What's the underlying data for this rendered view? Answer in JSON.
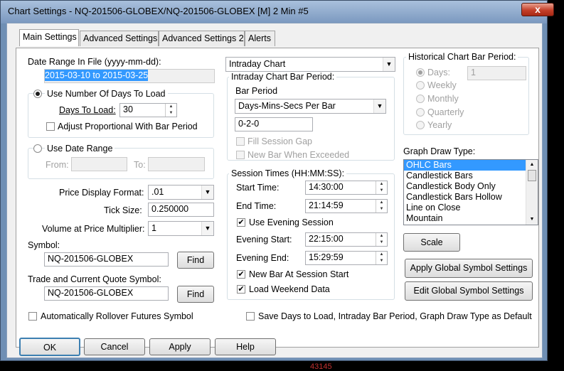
{
  "window": {
    "title": "Chart Settings - NQ-201506-GLOBEX/NQ-201506-GLOBEX [M]  2 Min  #5",
    "close": "x"
  },
  "tabs": [
    {
      "label": "Main Settings"
    },
    {
      "label": "Advanced Settings"
    },
    {
      "label": "Advanced Settings 2"
    },
    {
      "label": "Alerts"
    }
  ],
  "date_range_file": {
    "label": "Date Range In File (yyyy-mm-dd):",
    "value": "2015-03-10 to 2015-03-25"
  },
  "days_to_load": {
    "radio_label": "Use Number Of Days To Load",
    "days_label": "Days To Load:",
    "days_value": "30",
    "adjust_label": "Adjust Proportional With Bar Period"
  },
  "date_range": {
    "radio_label": "Use Date Range",
    "from_label": "From:",
    "to_label": "To:"
  },
  "price_display_format": {
    "label": "Price Display Format:",
    "value": ".01"
  },
  "tick_size": {
    "label": "Tick Size:",
    "value": "0.250000"
  },
  "volume_multiplier": {
    "label": "Volume at Price Multiplier:",
    "value": "1"
  },
  "symbol": {
    "label": "Symbol:",
    "value": "NQ-201506-GLOBEX",
    "find": "Find"
  },
  "trade_symbol": {
    "label": "Trade and Current Quote Symbol:",
    "value": "NQ-201506-GLOBEX",
    "find": "Find"
  },
  "auto_rollover": {
    "label": "Automatically Rollover Futures Symbol"
  },
  "chart_type": {
    "value": "Intraday Chart"
  },
  "intraday_period": {
    "group_label": "Intraday Chart Bar Period:",
    "bar_period_label": "Bar Period",
    "bar_period_value": "Days-Mins-Secs Per Bar",
    "period_value": "0-2-0",
    "fill_gap": "Fill Session Gap",
    "new_bar_exceeded": "New Bar When Exceeded"
  },
  "session_times": {
    "group_label": "Session Times (HH:MM:SS):",
    "start_label": "Start Time:",
    "start_value": "14:30:00",
    "end_label": "End Time:",
    "end_value": "21:14:59",
    "use_evening": "Use Evening Session",
    "evening_start_label": "Evening Start:",
    "evening_start_value": "22:15:00",
    "evening_end_label": "Evening End:",
    "evening_end_value": "15:29:59",
    "new_bar_session": "New Bar At Session Start",
    "load_weekend": "Load Weekend Data"
  },
  "historical_period": {
    "group_label": "Historical Chart Bar Period:",
    "options": [
      "Days:",
      "Weekly",
      "Monthly",
      "Quarterly",
      "Yearly"
    ],
    "days_value": "1"
  },
  "graph_draw_type": {
    "label": "Graph Draw Type:",
    "items": [
      "OHLC Bars",
      "Candlestick Bars",
      "Candlestick Body Only",
      "Candlestick Bars Hollow",
      "Line on Close",
      "Mountain"
    ]
  },
  "buttons": {
    "scale": "Scale",
    "apply_global": "Apply Global Symbol Settings",
    "edit_global": "Edit Global Symbol Settings",
    "ok": "OK",
    "cancel": "Cancel",
    "apply": "Apply",
    "help": "Help"
  },
  "save_defaults": {
    "label": "Save Days to Load, Intraday Bar Period, Graph Draw Type as Default"
  },
  "background": {
    "overlay_text": "43145"
  }
}
